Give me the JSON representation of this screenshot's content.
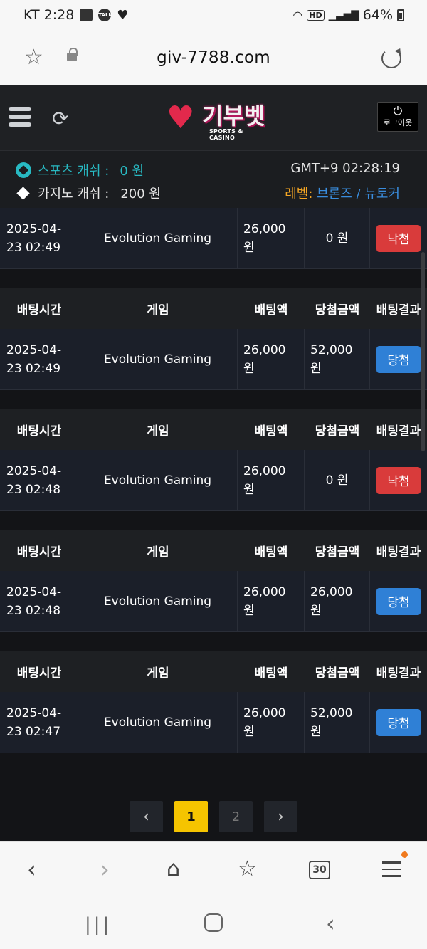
{
  "statusbar": {
    "carrier_time": "KT 2:28",
    "talk_label": "TALK",
    "battery": "64%"
  },
  "browser": {
    "url": "giv-7788.com"
  },
  "header": {
    "logo_text": "기부벳",
    "logo_sub": "SPORTS & CASINO",
    "logout_label": "로그아웃"
  },
  "info": {
    "sports_label": "스포츠 캐쉬 :",
    "sports_value": "0 원",
    "casino_label": "카지노 캐쉬 :",
    "casino_value": "200 원",
    "clock": "GMT+9 02:28:19",
    "level_label": "레벨:",
    "level_value": "브론즈 / 뉴토커"
  },
  "table_headers": [
    "배팅시간",
    "게임",
    "배팅액",
    "당첨금액",
    "배팅결과"
  ],
  "rows": [
    {
      "date": "2025-04-",
      "time": "23 02:49",
      "game": "Evolution Gaming",
      "bet_amt": "26,000",
      "bet_unit": "원",
      "win_amt": "0 원",
      "win_unit": "",
      "result": "낙첨",
      "status": "lose"
    },
    {
      "date": "2025-04-",
      "time": "23 02:49",
      "game": "Evolution Gaming",
      "bet_amt": "26,000",
      "bet_unit": "원",
      "win_amt": "52,000",
      "win_unit": "원",
      "result": "당첨",
      "status": "win"
    },
    {
      "date": "2025-04-",
      "time": "23 02:48",
      "game": "Evolution Gaming",
      "bet_amt": "26,000",
      "bet_unit": "원",
      "win_amt": "0 원",
      "win_unit": "",
      "result": "낙첨",
      "status": "lose"
    },
    {
      "date": "2025-04-",
      "time": "23 02:48",
      "game": "Evolution Gaming",
      "bet_amt": "26,000",
      "bet_unit": "원",
      "win_amt": "26,000",
      "win_unit": "원",
      "result": "당첨",
      "status": "win"
    },
    {
      "date": "2025-04-",
      "time": "23 02:47",
      "game": "Evolution Gaming",
      "bet_amt": "26,000",
      "bet_unit": "원",
      "win_amt": "52,000",
      "win_unit": "원",
      "result": "당첨",
      "status": "win"
    }
  ],
  "pagination": {
    "prev": "‹",
    "pages": [
      "1",
      "2"
    ],
    "current": "1",
    "next": "›"
  },
  "bottom_nav": {
    "tabs_count": "30"
  },
  "colors": {
    "win": "#2f80d6",
    "lose": "#d93b3b",
    "active_page": "#f5c400",
    "sports_cash": "#28b9c2",
    "level": "#f5a623"
  }
}
